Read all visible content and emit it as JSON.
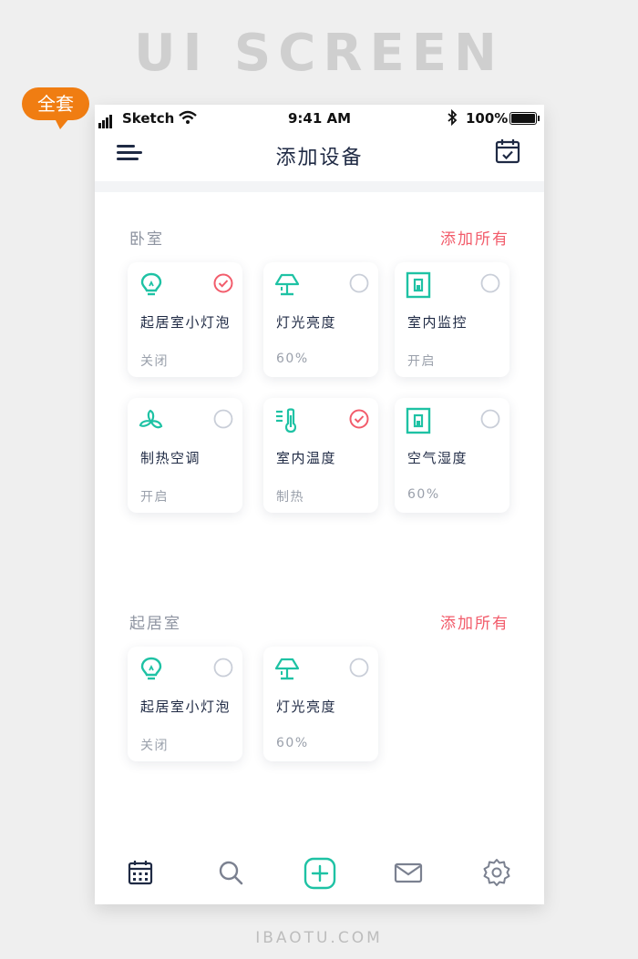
{
  "banner": {
    "title": "UI SCREEN",
    "badge": "全套"
  },
  "status_bar": {
    "carrier": "Sketch",
    "time": "9:41 AM",
    "battery": "100%"
  },
  "nav": {
    "title": "添加设备"
  },
  "sections": [
    {
      "title": "卧室",
      "action": "添加所有",
      "devices": [
        {
          "name": "起居室小灯泡",
          "state": "关闭",
          "icon": "bulb-icon",
          "checked": true
        },
        {
          "name": "灯光亮度",
          "state": "60%",
          "icon": "lamp-icon",
          "checked": false
        },
        {
          "name": "室内监控",
          "state": "开启",
          "icon": "switch-icon",
          "checked": false
        },
        {
          "name": "制热空调",
          "state": "开启",
          "icon": "fan-icon",
          "checked": false
        },
        {
          "name": "室内温度",
          "state": "制热",
          "icon": "thermometer-icon",
          "checked": true
        },
        {
          "name": "空气湿度",
          "state": "60%",
          "icon": "switch-icon",
          "checked": false
        }
      ]
    },
    {
      "title": "起居室",
      "action": "添加所有",
      "devices": [
        {
          "name": "起居室小灯泡",
          "state": "关闭",
          "icon": "bulb-icon",
          "checked": false
        },
        {
          "name": "灯光亮度",
          "state": "60%",
          "icon": "lamp-icon",
          "checked": false
        }
      ]
    }
  ],
  "tabbar": {
    "items": [
      {
        "icon": "calendar-icon"
      },
      {
        "icon": "search-icon"
      },
      {
        "icon": "add-icon",
        "active": true
      },
      {
        "icon": "mail-icon"
      },
      {
        "icon": "settings-icon"
      }
    ]
  },
  "footer": "IBAOTU.COM",
  "colors": {
    "accent": "#1ec2a4",
    "danger": "#f25c6b",
    "ink": "#1f2a44",
    "muted": "#9aa0ab"
  }
}
